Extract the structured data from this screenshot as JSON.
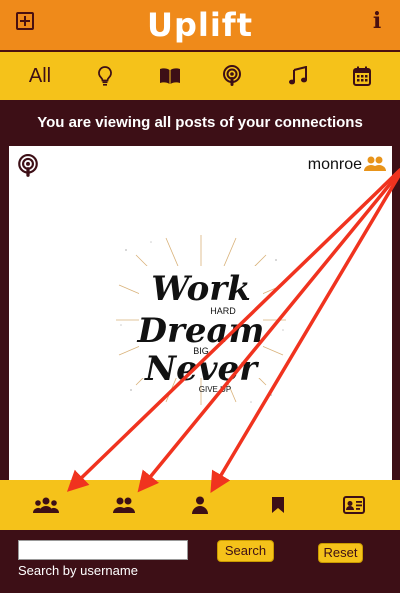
{
  "header": {
    "title": "Uplift",
    "add_icon": "plus-square-icon",
    "info_icon": "info-icon",
    "brand_color": "#ef8a1a"
  },
  "categories": {
    "all_label": "All",
    "icons": [
      "lightbulb-icon",
      "book-icon",
      "podcast-icon",
      "music-icon",
      "calendar-icon"
    ],
    "bar_color": "#f5c21a"
  },
  "banner": {
    "text": "You are viewing all posts of your connections"
  },
  "post": {
    "type_icon": "podcast-icon",
    "username": "monroe",
    "user_icon": "connections-icon",
    "image": {
      "lines": [
        "Work",
        "HARD",
        "Dream",
        "BIG",
        "Never",
        "GIVE UP"
      ]
    }
  },
  "bottom_nav": {
    "icons": [
      "all-connections-icon",
      "connections-icon",
      "user-icon",
      "bookmark-icon",
      "profile-card-icon"
    ]
  },
  "search": {
    "placeholder": "",
    "hint": "Search by username",
    "search_label": "Search",
    "reset_label": "Reset"
  },
  "annotation": {
    "arrow_color": "#f0331f"
  }
}
